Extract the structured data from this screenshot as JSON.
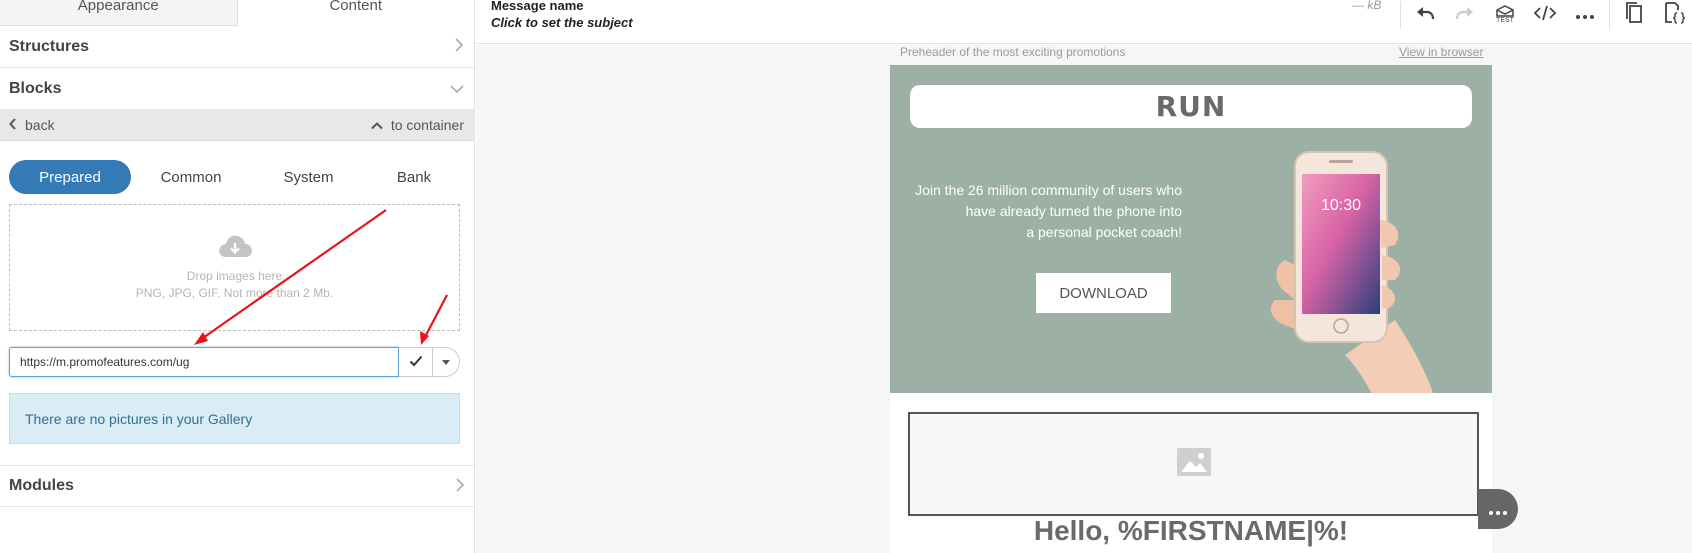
{
  "sidebar": {
    "tabs": [
      {
        "label": "Appearance"
      },
      {
        "label": "Content"
      }
    ],
    "sections": {
      "structures": "Structures",
      "blocks": "Blocks",
      "modules": "Modules"
    },
    "nav": {
      "back": "back",
      "to_container": "to container"
    },
    "block_tabs": [
      {
        "label": "Prepared",
        "active": true
      },
      {
        "label": "Common"
      },
      {
        "label": "System"
      },
      {
        "label": "Bank"
      }
    ],
    "dropzone": {
      "line1": "Drop images here",
      "line2": "PNG, JPG, GIF. Not more than 2 Mb."
    },
    "url_input": {
      "value": "https://m.promofeatures.com/ug"
    },
    "gallery_note": "There are no pictures in your Gallery"
  },
  "header": {
    "message_name": "Message name",
    "subject_prompt": "Click to set the subject",
    "size": "— kB",
    "test_label": "TEST"
  },
  "toolbar_icons": [
    "undo-icon",
    "redo-icon",
    "test-email-icon",
    "code-icon",
    "more-icon",
    "copy-icon",
    "settings-code-icon"
  ],
  "email": {
    "preheader": "Preheader of the most exciting promotions",
    "view_in_browser": "View in browser",
    "logo_text": "RUN",
    "hero_text": [
      "Join the 26 million community of users who",
      "have already turned the phone into",
      "a personal pocket coach!"
    ],
    "download_label": "DOWNLOAD",
    "phone_time": "10:30",
    "greeting": "Hello, %FIRSTNAME|%!"
  },
  "colors": {
    "accent": "#337ab7",
    "hero_bg": "#9cb0a5",
    "info_bg": "#d9edf7",
    "info_text": "#31708f",
    "annotation_arrow": "#e8141c"
  }
}
